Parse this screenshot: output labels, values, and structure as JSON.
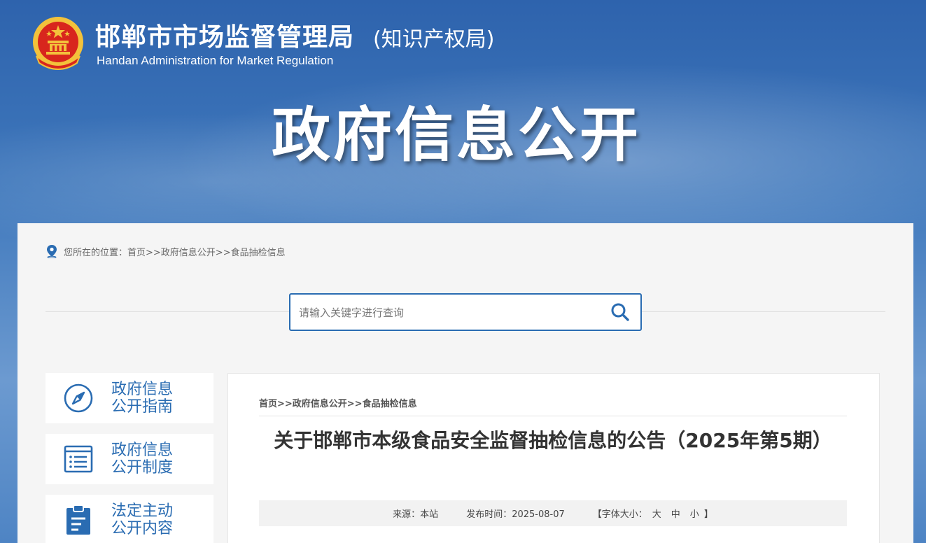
{
  "header": {
    "title": "邯郸市市场监督管理局",
    "subtitle": "(知识产权局)",
    "english": "Handan Administration for Market Regulation",
    "emblem_icon": "national-emblem-icon",
    "hero": "政府信息公开"
  },
  "location": {
    "icon": "location-pin-icon",
    "label": "您所在的位置：",
    "path": "首页>>政府信息公开>>食品抽检信息"
  },
  "search": {
    "placeholder": "请输入关键字进行查询",
    "icon": "search-icon"
  },
  "sidebar": {
    "items": [
      {
        "line1": "政府信息",
        "line2": "公开指南",
        "icon": "compass-icon"
      },
      {
        "line1": "政府信息",
        "line2": "公开制度",
        "icon": "list-document-icon"
      },
      {
        "line1": "法定主动",
        "line2": "公开内容",
        "icon": "clipboard-icon"
      }
    ]
  },
  "article": {
    "breadcrumb": "首页>>政府信息公开>>食品抽检信息",
    "title": "关于邯郸市本级食品安全监督抽检信息的公告（2025年第5期）",
    "source": "来源：本站",
    "published": "发布时间：2025-08-07",
    "font_size_label": "【字体大小：",
    "font_large": "大",
    "font_medium": "中",
    "font_small": "小",
    "font_size_end": "】"
  },
  "colors": {
    "accent": "#2a6cb2",
    "banner": "#3a6fb0",
    "emblem_red": "#d8261d",
    "emblem_gold": "#f3c23b"
  }
}
